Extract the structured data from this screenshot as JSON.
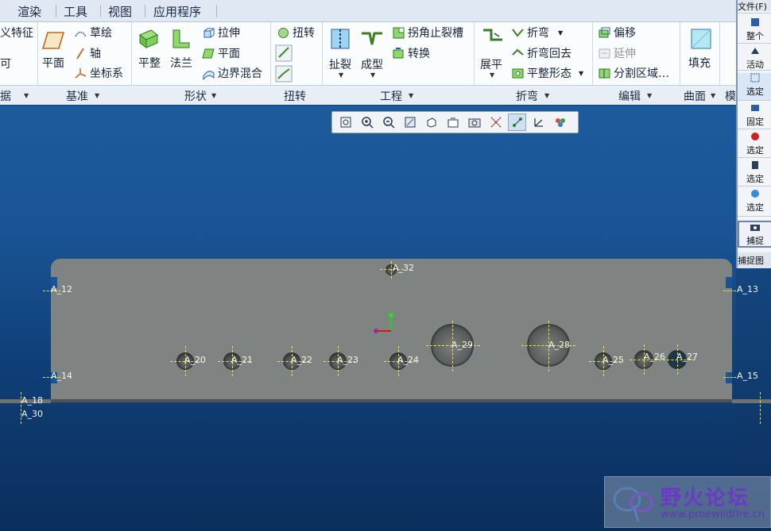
{
  "tabs": [
    "渲染",
    "工具",
    "视图",
    "应用程序"
  ],
  "ribbon": {
    "model_items": [
      "义特征",
      "可"
    ],
    "datum": {
      "plane": "平面",
      "sketch": "草绘",
      "axis": "轴",
      "csys": "坐标系"
    },
    "shape": {
      "flat": "平整",
      "flange": "法兰",
      "extrude": "拉伸",
      "planar": "平面",
      "boundary_blend": "边界混合"
    },
    "twist": {
      "twist": "扭转"
    },
    "engineering": {
      "rip": "扯裂",
      "form": "成型",
      "corner_relief": "拐角止裂槽",
      "convert": "转换"
    },
    "bend": {
      "unbend": "展平",
      "bend": "折弯",
      "bend_back": "折弯回去",
      "flatten_form": "平整形态"
    },
    "editing": {
      "offset": "偏移",
      "extend": "延伸",
      "split_area": "分割区域…"
    },
    "surface": {
      "fill": "填充"
    }
  },
  "groups": [
    "据",
    "基准",
    "形状",
    "扭转",
    "工程",
    "折弯",
    "编辑",
    "曲面",
    "模"
  ],
  "right_panel": [
    "文件(F)",
    "整个",
    "活动",
    "选定",
    "固定",
    "选定",
    "选定",
    "选定",
    "捕捉",
    "捕捉图"
  ],
  "viewtools": [
    "refit",
    "zoom-in",
    "zoom-out",
    "reorient",
    "display-style",
    "saved-views",
    "snapshot",
    "datum-display",
    "spin-center",
    "named-view",
    "appearance"
  ],
  "axes": {
    "a32": "A_32",
    "a12": "A_12",
    "a13": "A_13",
    "a14": "A_14",
    "a15": "A_15",
    "a18": "A_18",
    "a30": "A_30",
    "a20": "A_20",
    "a21": "A_21",
    "a22": "A_22",
    "a23": "A_23",
    "a24": "A_24",
    "a25": "A_25",
    "a26": "A_26",
    "a27": "A_27",
    "a28": "A_28",
    "a29": "A_29"
  },
  "watermark": {
    "title": "野火论坛",
    "url": "www.proewildfire.cn"
  },
  "colors": {
    "background": "#1a5494",
    "part": "#7f8483",
    "axis": "#f1e33b",
    "ribbon": "#fbfcfe"
  }
}
